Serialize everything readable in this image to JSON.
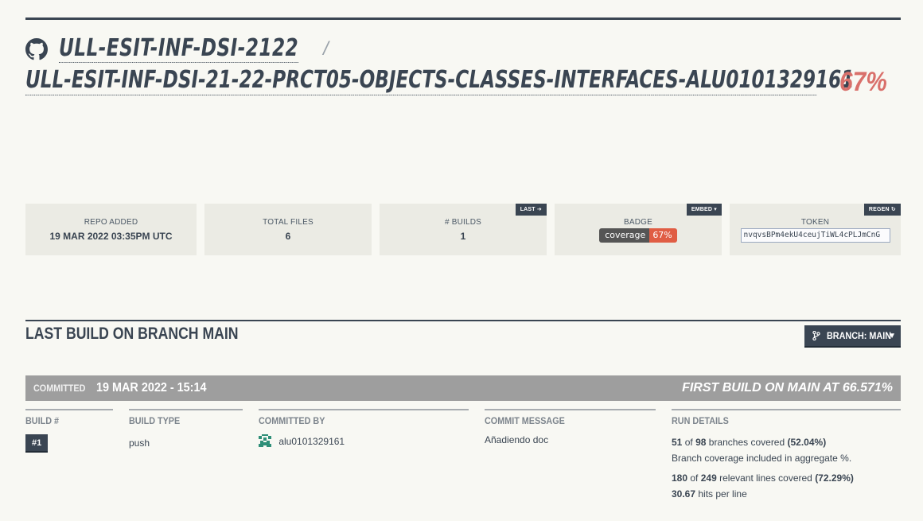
{
  "header": {
    "org": "ULL-ESIT-INF-DSI-2122",
    "separator": "/",
    "repo": "ULL-ESIT-INF-DSI-21-22-PRCT05-OBJECTS-CLASSES-INTERFACES-ALU0101329161",
    "coverage": "67%"
  },
  "stats": {
    "repo_added_label": "REPO ADDED",
    "repo_added_value": "19 MAR 2022 03:35PM UTC",
    "total_files_label": "TOTAL FILES",
    "total_files_value": "6",
    "builds_label": "# BUILDS",
    "builds_value": "1",
    "last_button": "LAST",
    "badge_label": "BADGE",
    "embed_button": "EMBED ▾",
    "badge_left": "coverage",
    "badge_right": "67%",
    "token_label": "TOKEN",
    "regen_button": "REGEN",
    "token_value": "nvqvsBPm4ekU4ceujTiWL4cPLJmCnG"
  },
  "section": {
    "title": "LAST BUILD ON BRANCH MAIN",
    "branch_button": "BRANCH: MAIN"
  },
  "commit": {
    "committed_label": "COMMITTED",
    "committed_date": "19 MAR 2022 - 15:14",
    "first_build": "FIRST BUILD ON MAIN AT 66.571%"
  },
  "columns": {
    "build_num_head": "BUILD #",
    "build_num": "#1",
    "build_type_head": "BUILD TYPE",
    "build_type": "push",
    "committed_by_head": "COMMITTED BY",
    "committed_by": "alu0101329161",
    "message_head": "COMMIT MESSAGE",
    "message": "Añadiendo doc",
    "run_head": "RUN DETAILS",
    "branches_covered": "51",
    "branches_of": "of",
    "branches_total": "98",
    "branches_text": "branches covered",
    "branches_pct": "(52.04%)",
    "branch_note": "Branch coverage included in aggregate %.",
    "lines_covered": "180",
    "lines_of": "of",
    "lines_total": "249",
    "lines_text": "relevant lines covered",
    "lines_pct": "(72.29%)",
    "hits_value": "30.67",
    "hits_text": "hits per line"
  },
  "colors": {
    "primary": "#3a4552",
    "coverage_red": "#d9706b",
    "badge_red": "#e05d44",
    "commit_bar": "#9e9e9e"
  },
  "icons": [
    "github-icon",
    "arrow-circle-right-icon",
    "refresh-icon",
    "code-branch-icon",
    "caret-down-icon"
  ]
}
